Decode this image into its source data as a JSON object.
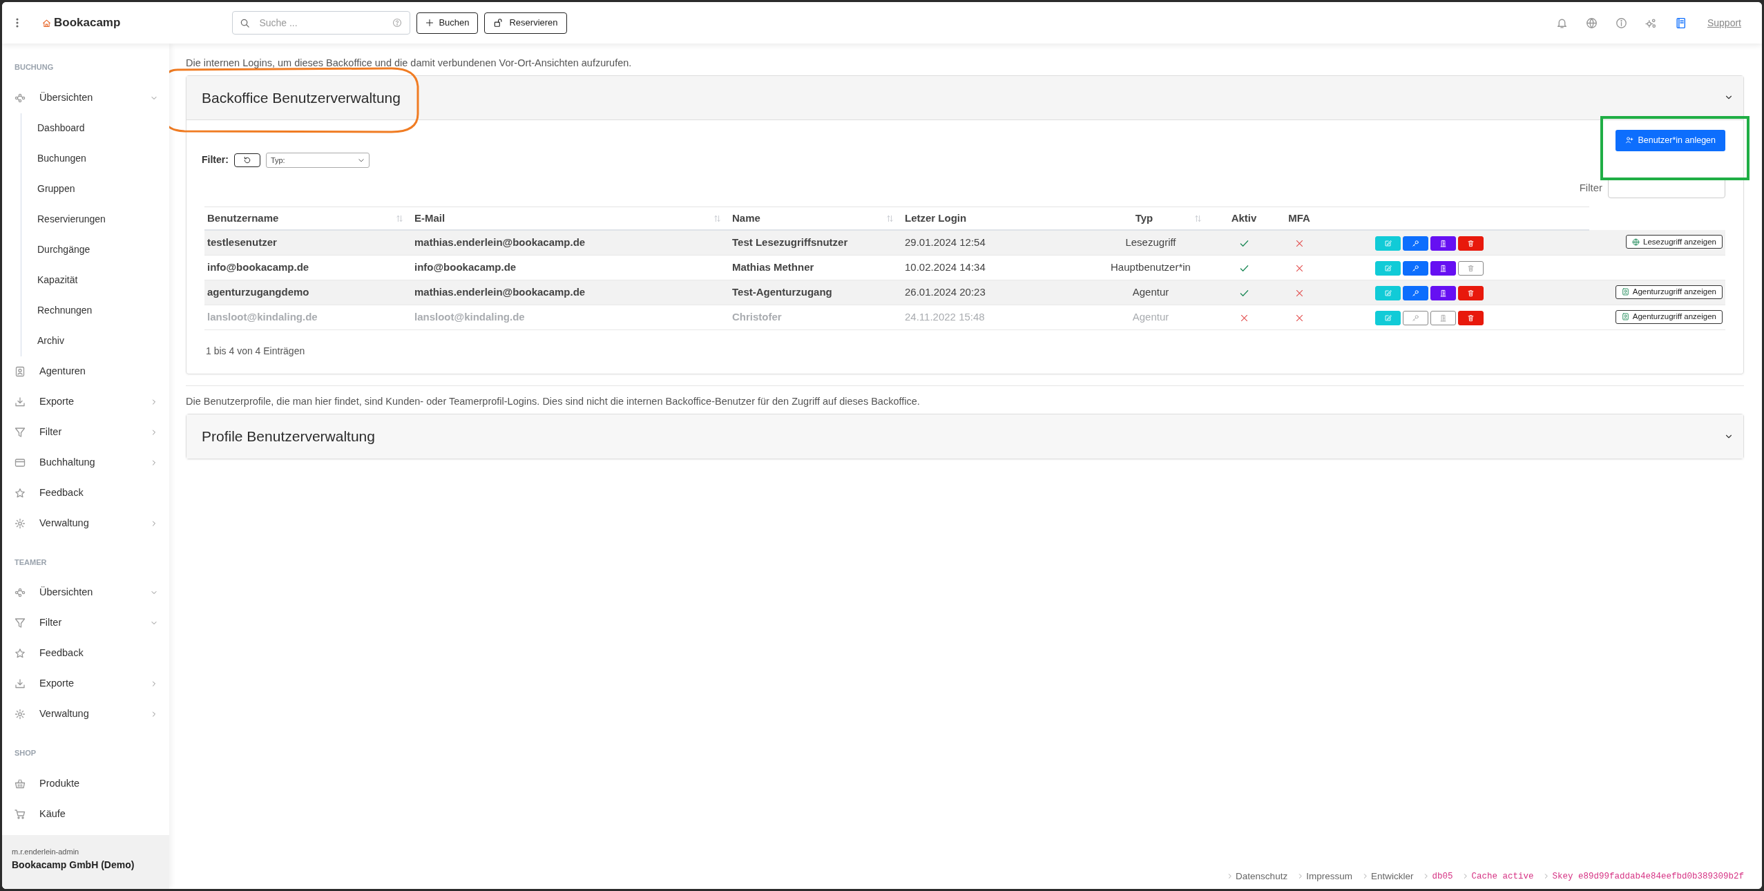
{
  "topbar": {
    "brand": "Bookacamp",
    "search": {
      "placeholder": "Suche ..."
    },
    "buttons": [
      {
        "label": "Buchen",
        "kind": "plus"
      },
      {
        "label": "Reservieren",
        "kind": "lock"
      }
    ],
    "support": "Support"
  },
  "sidebar": {
    "sections": [
      {
        "title": "BUCHUNG",
        "items": [
          {
            "label": "Übersichten",
            "expanded": true,
            "children": [
              {
                "label": "Dashboard"
              },
              {
                "label": "Buchungen"
              },
              {
                "label": "Gruppen"
              },
              {
                "label": "Reservierungen"
              },
              {
                "label": "Durchgänge"
              },
              {
                "label": "Kapazität"
              },
              {
                "label": "Rechnungen"
              },
              {
                "label": "Archiv"
              }
            ]
          },
          {
            "label": "Agenturen"
          },
          {
            "label": "Exporte",
            "expanded": false
          },
          {
            "label": "Filter",
            "expanded": false
          },
          {
            "label": "Buchhaltung",
            "expanded": false
          },
          {
            "label": "Feedback"
          },
          {
            "label": "Verwaltung",
            "expanded": false
          }
        ]
      },
      {
        "title": "TEAMER",
        "items": [
          {
            "label": "Übersichten",
            "expanded": true
          },
          {
            "label": "Filter",
            "expanded": true
          },
          {
            "label": "Feedback"
          },
          {
            "label": "Exporte",
            "expanded": false
          },
          {
            "label": "Verwaltung",
            "expanded": false
          }
        ]
      },
      {
        "title": "SHOP",
        "items": [
          {
            "label": "Produkte"
          },
          {
            "label": "Käufe"
          }
        ]
      }
    ],
    "user": {
      "login": "m.r.enderlein-admin",
      "company": "Bookacamp GmbH (Demo)"
    }
  },
  "backoffice": {
    "intro": "Die internen Logins, um dieses Backoffice und die damit verbundenen Vor-Ort-Ansichten aufzurufen.",
    "title": "Backoffice Benutzerverwaltung",
    "expanded": true,
    "create_button": "Benutzer*in anlegen",
    "filter_label": "Filter:",
    "type_select": "Typ:",
    "search_label": "Filter",
    "table": {
      "columns": [
        {
          "label": "Benutzername",
          "sortable": true
        },
        {
          "label": "E-Mail",
          "sortable": true
        },
        {
          "label": "Name",
          "sortable": true
        },
        {
          "label": "Letzer Login",
          "sortable": false
        },
        {
          "label": "Typ",
          "sortable": true
        },
        {
          "label": "Aktiv",
          "sortable": false
        },
        {
          "label": "MFA",
          "sortable": false
        }
      ],
      "rows": [
        {
          "username": "testlesenutzer",
          "email": "mathias.enderlein@bookacamp.de",
          "name": "Test Lesezugriffsnutzer",
          "last_login": "29.01.2024 12:54",
          "type": "Lesezugriff",
          "aktiv": true,
          "mfa": false,
          "disabled": false,
          "actions": [
            {
              "kind": "edit",
              "enabled": true
            },
            {
              "kind": "key",
              "enabled": true
            },
            {
              "kind": "access",
              "enabled": true
            },
            {
              "kind": "delete",
              "enabled": true
            }
          ],
          "view": {
            "label": "Lesezugriff anzeigen",
            "kind": "globe"
          }
        },
        {
          "username": "info@bookacamp.de",
          "email": "info@bookacamp.de",
          "name": "Mathias Methner",
          "last_login": "10.02.2024 14:34",
          "type": "Hauptbenutzer*in",
          "aktiv": true,
          "mfa": false,
          "disabled": false,
          "actions": [
            {
              "kind": "edit",
              "enabled": true
            },
            {
              "kind": "key",
              "enabled": true
            },
            {
              "kind": "access",
              "enabled": true
            },
            {
              "kind": "delete",
              "enabled": false
            }
          ]
        },
        {
          "username": "agenturzugangdemo",
          "email": "mathias.enderlein@bookacamp.de",
          "name": "Test-Agenturzugang",
          "last_login": "26.01.2024 20:23",
          "type": "Agentur",
          "aktiv": true,
          "mfa": false,
          "disabled": false,
          "actions": [
            {
              "kind": "edit",
              "enabled": true
            },
            {
              "kind": "key",
              "enabled": true
            },
            {
              "kind": "access",
              "enabled": true
            },
            {
              "kind": "delete",
              "enabled": true
            }
          ],
          "view": {
            "label": "Agenturzugriff anzeigen",
            "kind": "card"
          }
        },
        {
          "username": "lansloot@kindaling.de",
          "email": "lansloot@kindaling.de",
          "name": "Christofer",
          "last_login": "24.11.2022 15:48",
          "type": "Agentur",
          "aktiv": false,
          "mfa": false,
          "disabled": true,
          "actions": [
            {
              "kind": "edit",
              "enabled": true
            },
            {
              "kind": "key",
              "enabled": false
            },
            {
              "kind": "access",
              "enabled": false
            },
            {
              "kind": "delete",
              "enabled": true
            }
          ],
          "view": {
            "label": "Agenturzugriff anzeigen",
            "kind": "card"
          }
        }
      ],
      "info": "1 bis 4 von 4 Einträgen"
    }
  },
  "profiles": {
    "intro": "Die Benutzerprofile, die man hier findet, sind Kunden- oder Teamerprofil-Logins. Dies sind nicht die internen Backoffice-Benutzer für den Zugriff auf dieses Backoffice.",
    "title": "Profile Benutzerverwaltung",
    "expanded": false
  },
  "footer": [
    {
      "label": "Datenschutz",
      "kind": "link"
    },
    {
      "label": "Impressum",
      "kind": "link"
    },
    {
      "label": "Entwickler",
      "kind": "link"
    },
    {
      "label": "db05",
      "kind": "code"
    },
    {
      "label": "Cache active",
      "kind": "code"
    },
    {
      "label": "Skey e89d99faddab4e84eefbd0b389309b2f",
      "kind": "code"
    }
  ]
}
